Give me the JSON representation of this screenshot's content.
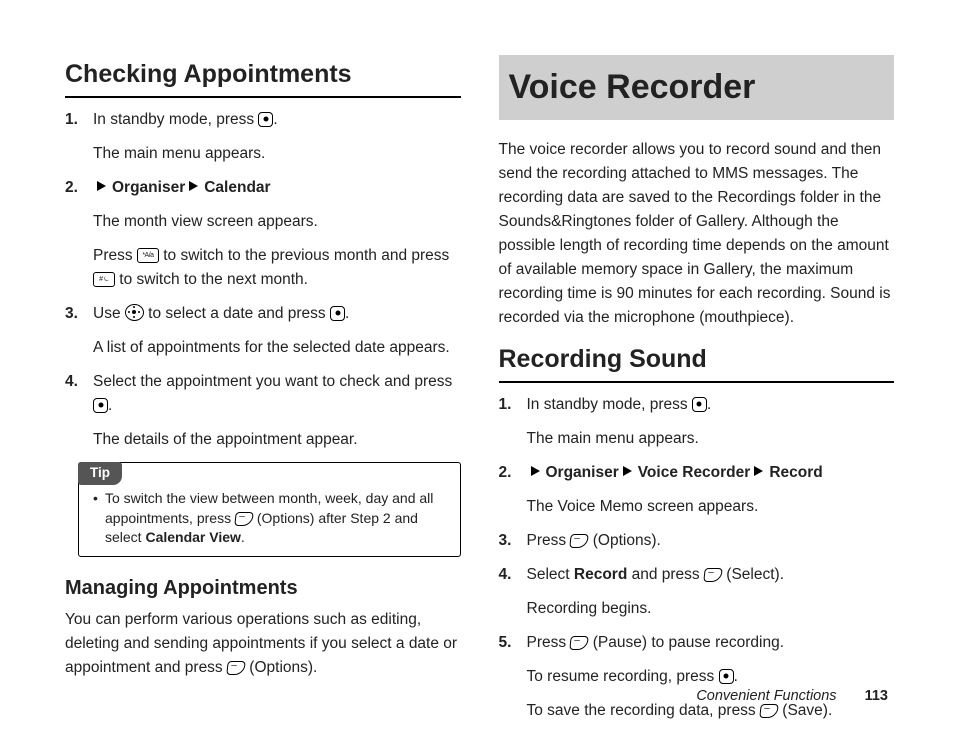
{
  "left": {
    "heading": "Checking Appointments",
    "steps": [
      {
        "num": "1.",
        "lines": [
          {
            "parts": [
              {
                "t": "In standby mode, press "
              },
              {
                "icon": "center"
              },
              {
                "t": "."
              }
            ]
          },
          {
            "parts": [
              {
                "t": "The main menu appears."
              }
            ]
          }
        ]
      },
      {
        "num": "2.",
        "lines": [
          {
            "parts": [
              {
                "tri": true
              },
              {
                "t": "Organiser",
                "b": true
              },
              {
                "tri": true
              },
              {
                "t": "Calendar",
                "b": true
              }
            ]
          },
          {
            "parts": [
              {
                "t": "The month view screen appears."
              }
            ]
          },
          {
            "parts": [
              {
                "t": "Press "
              },
              {
                "icon": "star"
              },
              {
                "t": " to switch to the previous month and press "
              },
              {
                "icon": "hash"
              },
              {
                "t": " to switch to the next month."
              }
            ]
          }
        ]
      },
      {
        "num": "3.",
        "lines": [
          {
            "parts": [
              {
                "t": "Use "
              },
              {
                "icon": "nav"
              },
              {
                "t": " to select a date and press "
              },
              {
                "icon": "center"
              },
              {
                "t": "."
              }
            ]
          },
          {
            "parts": [
              {
                "t": "A list of appointments for the selected date appears."
              }
            ]
          }
        ]
      },
      {
        "num": "4.",
        "lines": [
          {
            "parts": [
              {
                "t": "Select the appointment you want to check and press "
              },
              {
                "icon": "center"
              },
              {
                "t": "."
              }
            ]
          },
          {
            "parts": [
              {
                "t": "The details of the appointment appear."
              }
            ]
          }
        ]
      }
    ],
    "tip": {
      "label": "Tip",
      "body_parts": [
        {
          "t": "To switch the view between month, week, day and all appointments, press "
        },
        {
          "icon": "soft"
        },
        {
          "t": " (Options) after Step 2 and select "
        },
        {
          "t": "Calendar View",
          "b": true
        },
        {
          "t": "."
        }
      ]
    },
    "sub": {
      "title": "Managing Appointments",
      "body_parts": [
        {
          "t": "You can perform various operations such as editing, deleting and sending appointments if you select a date or appointment and press "
        },
        {
          "icon": "soft"
        },
        {
          "t": " (Options)."
        }
      ]
    }
  },
  "right": {
    "chapter": "Voice Recorder",
    "intro": "The voice recorder allows you to record sound and then send the recording attached to MMS messages. The recording data are saved to the Recordings folder in the Sounds&Ringtones folder of Gallery. Although the possible length of recording time depends on the amount of available memory space in Gallery, the maximum recording time is 90 minutes for each recording. Sound is recorded via the microphone (mouthpiece).",
    "heading": "Recording Sound",
    "steps": [
      {
        "num": "1.",
        "lines": [
          {
            "parts": [
              {
                "t": "In standby mode, press "
              },
              {
                "icon": "center"
              },
              {
                "t": "."
              }
            ]
          },
          {
            "parts": [
              {
                "t": "The main menu appears."
              }
            ]
          }
        ]
      },
      {
        "num": "2.",
        "lines": [
          {
            "parts": [
              {
                "tri": true
              },
              {
                "t": "Organiser",
                "b": true
              },
              {
                "tri": true
              },
              {
                "t": "Voice Recorder",
                "b": true
              },
              {
                "tri": true
              },
              {
                "t": "Record",
                "b": true
              }
            ]
          },
          {
            "parts": [
              {
                "t": "The Voice Memo screen appears."
              }
            ]
          }
        ]
      },
      {
        "num": "3.",
        "lines": [
          {
            "parts": [
              {
                "t": "Press "
              },
              {
                "icon": "soft"
              },
              {
                "t": " (Options)."
              }
            ]
          }
        ]
      },
      {
        "num": "4.",
        "lines": [
          {
            "parts": [
              {
                "t": "Select "
              },
              {
                "t": "Record",
                "b": true
              },
              {
                "t": " and press "
              },
              {
                "icon": "soft"
              },
              {
                "t": " (Select)."
              }
            ]
          },
          {
            "parts": [
              {
                "t": "Recording begins."
              }
            ]
          }
        ]
      },
      {
        "num": "5.",
        "lines": [
          {
            "parts": [
              {
                "t": "Press "
              },
              {
                "icon": "soft"
              },
              {
                "t": " (Pause) to pause recording."
              }
            ]
          },
          {
            "parts": [
              {
                "t": "To resume recording, press "
              },
              {
                "icon": "center"
              },
              {
                "t": "."
              }
            ]
          },
          {
            "parts": [
              {
                "t": "To save the recording data, press "
              },
              {
                "icon": "soft"
              },
              {
                "t": " (Save)."
              }
            ]
          }
        ]
      }
    ]
  },
  "footer": {
    "section": "Convenient Functions",
    "page": "113"
  }
}
